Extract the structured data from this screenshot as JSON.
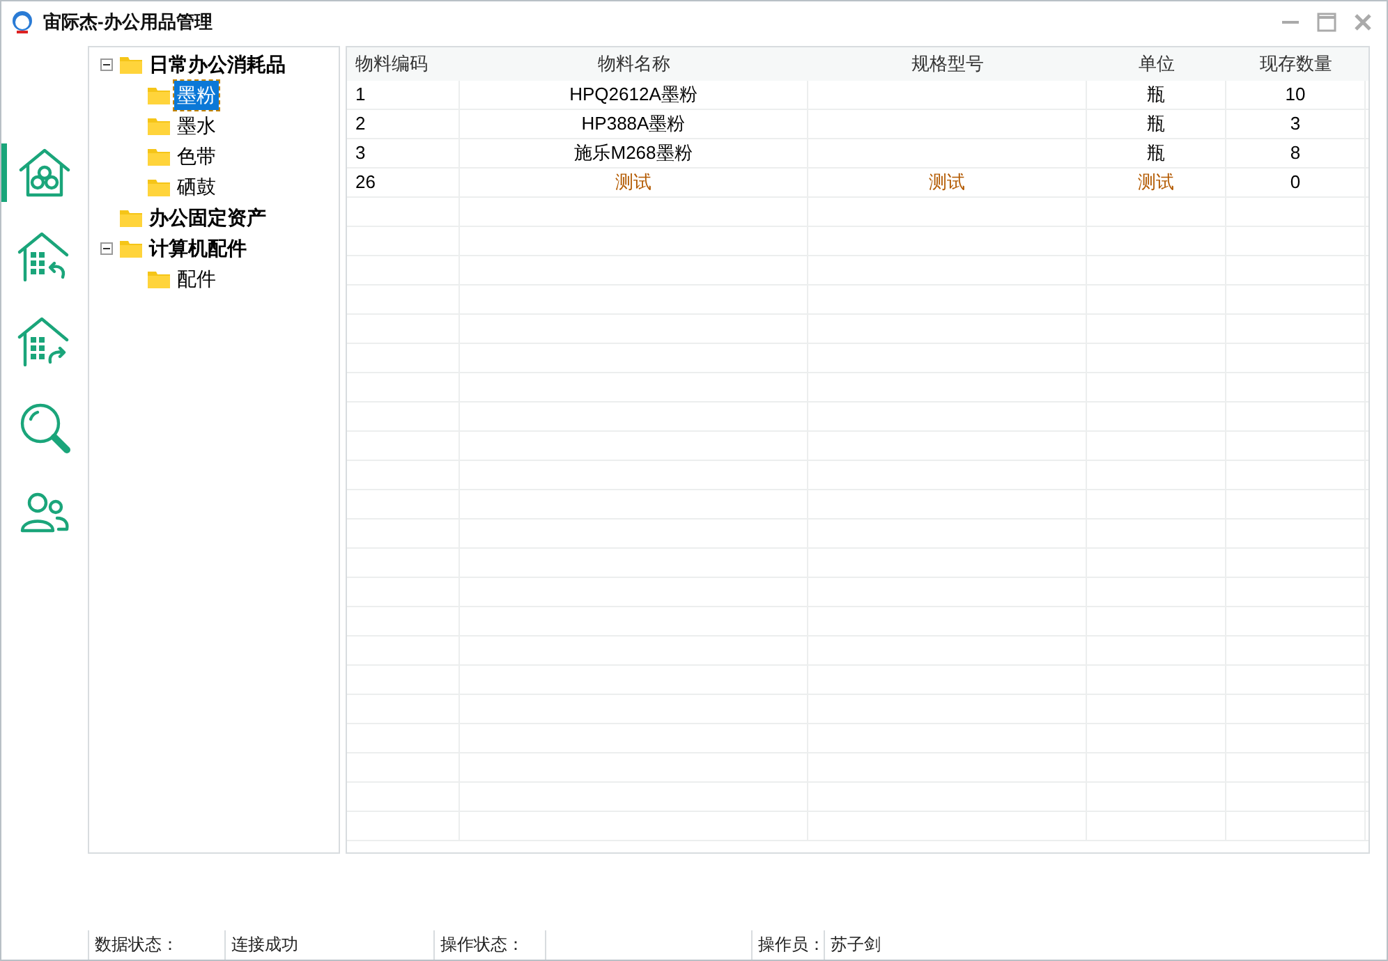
{
  "window": {
    "title": "宙际杰-办公用品管理"
  },
  "nav": [
    {
      "kind": "home",
      "selected": true
    },
    {
      "kind": "inbound",
      "selected": false
    },
    {
      "kind": "outbound",
      "selected": false
    },
    {
      "kind": "search",
      "selected": false
    },
    {
      "kind": "users",
      "selected": false
    }
  ],
  "tree": [
    {
      "label": "日常办公消耗品",
      "expanded": true,
      "selected": false,
      "children": [
        {
          "label": "墨粉",
          "selected": true
        },
        {
          "label": "墨水",
          "selected": false
        },
        {
          "label": "色带",
          "selected": false
        },
        {
          "label": "硒鼓",
          "selected": false
        }
      ]
    },
    {
      "label": "办公固定资产",
      "selected": false
    },
    {
      "label": "计算机配件",
      "expanded": true,
      "selected": false,
      "children": [
        {
          "label": "配件",
          "selected": false
        }
      ]
    }
  ],
  "table": {
    "columns": [
      "物料编码",
      "物料名称",
      "规格型号",
      "单位",
      "现存数量"
    ],
    "rows": [
      {
        "color": "#000000",
        "cells": [
          "1",
          "HPQ2612A墨粉",
          "",
          "瓶",
          "10"
        ]
      },
      {
        "color": "#000000",
        "cells": [
          "2",
          "HP388A墨粉",
          "",
          "瓶",
          "3"
        ]
      },
      {
        "color": "#000000",
        "cells": [
          "3",
          "施乐M268墨粉",
          "",
          "瓶",
          "8"
        ]
      },
      {
        "color": "#b35a00",
        "cells": [
          "26",
          "测试",
          "测试",
          "测试",
          "0"
        ]
      }
    ]
  },
  "status_bar": [
    {
      "label": "数据状态：",
      "value": "连接成功"
    },
    {
      "label": "操作状态："
    },
    {
      "label": "操作员：",
      "value": "苏子剑"
    }
  ]
}
